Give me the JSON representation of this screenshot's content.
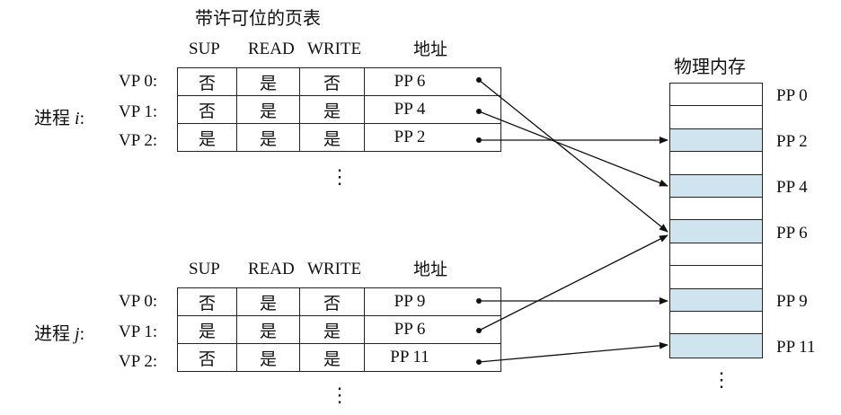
{
  "table_title": "带许可位的页表",
  "memory_title": "物理内存",
  "columns": [
    "SUP",
    "READ",
    "WRITE",
    "地址"
  ],
  "processes": [
    {
      "label_prefix": "进程",
      "var": "i",
      "label_suffix": ":",
      "rows": [
        {
          "vp": "VP 0:",
          "sup": "否",
          "read": "是",
          "write": "否",
          "addr": "PP 6"
        },
        {
          "vp": "VP 1:",
          "sup": "否",
          "read": "是",
          "write": "是",
          "addr": "PP 4"
        },
        {
          "vp": "VP 2:",
          "sup": "是",
          "read": "是",
          "write": "是",
          "addr": "PP 2"
        }
      ]
    },
    {
      "label_prefix": "进程",
      "var": "j",
      "label_suffix": ":",
      "rows": [
        {
          "vp": "VP 0:",
          "sup": "否",
          "read": "是",
          "write": "否",
          "addr": "PP 9"
        },
        {
          "vp": "VP 1:",
          "sup": "是",
          "read": "是",
          "write": "是",
          "addr": "PP 6"
        },
        {
          "vp": "VP 2:",
          "sup": "否",
          "read": "是",
          "write": "是",
          "addr": "PP 11"
        }
      ]
    }
  ],
  "memory": {
    "labels": [
      "PP 0",
      "PP 2",
      "PP 4",
      "PP 6",
      "PP 9",
      "PP 11"
    ],
    "highlighted_pages": [
      2,
      4,
      6,
      9,
      11
    ],
    "highlight_color": "#cfe4ee"
  },
  "ellipsis": "⋮"
}
